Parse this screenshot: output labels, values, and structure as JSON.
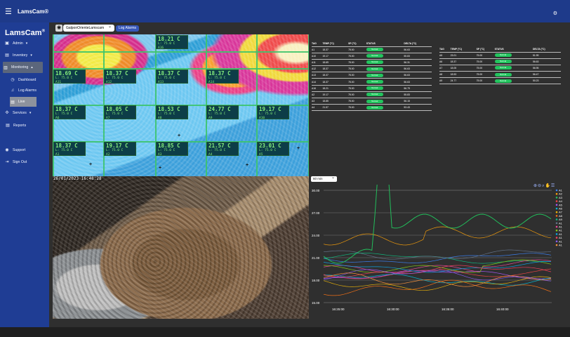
{
  "app": {
    "topbar_title": "LamsCam®",
    "brand": "LamsCam",
    "brand_mark": "®"
  },
  "sidebar": {
    "items": [
      {
        "label": "Admin",
        "icon": "admin-icon"
      },
      {
        "label": "Inventory",
        "icon": "inventory-icon"
      },
      {
        "label": "Monitoring",
        "icon": "monitoring-icon"
      },
      {
        "label": "Dashboard",
        "icon": "dashboard-icon"
      },
      {
        "label": "Log Alarms",
        "icon": "bell-icon"
      },
      {
        "label": "Live",
        "icon": "live-icon"
      },
      {
        "label": "Services",
        "icon": "services-icon"
      },
      {
        "label": "Reports",
        "icon": "reports-icon"
      },
      {
        "label": "Support",
        "icon": "support-icon"
      },
      {
        "label": "Sign Out",
        "icon": "sign-out-icon"
      }
    ],
    "admin_arrow": "▾",
    "inventory_arrow": "▾",
    "monitoring_arrow": "▴",
    "services_arrow": "▾"
  },
  "camera": {
    "selected": "GalponOrienteLamscam",
    "log_button": "Log Alarms",
    "timestamp": "26/01/2023 16:48:28",
    "readings": [
      {
        "temp": "18.21 C",
        "sp": "L: 75.0 C",
        "tag": "A16"
      },
      {
        "temp": "18.69 C",
        "sp": "L: 75.0 C",
        "tag": "A11"
      },
      {
        "temp": "18.37 C",
        "sp": "L: 75.0 C",
        "tag": "A12"
      },
      {
        "temp": "18.37 C",
        "sp": "L: 75.0 C",
        "tag": "A13"
      },
      {
        "temp": "18.37 C",
        "sp": "L: 75.0 C",
        "tag": "A14"
      },
      {
        "temp": "18.37 C",
        "sp": "L: 75.0 C",
        "tag": "A6"
      },
      {
        "temp": "18.05 C",
        "sp": "L: 75.0 C",
        "tag": "A7"
      },
      {
        "temp": "18.53 C",
        "sp": "L: 75.0 C",
        "tag": "A8"
      },
      {
        "temp": "24.77 C",
        "sp": "L: 75.0 C",
        "tag": "A9"
      },
      {
        "temp": "19.17 C",
        "sp": "L: 75.0 C",
        "tag": "A10"
      },
      {
        "temp": "18.37 C",
        "sp": "L: 75.0 C",
        "tag": "A1"
      },
      {
        "temp": "19.17 C",
        "sp": "L: 75.0 C",
        "tag": "A2"
      },
      {
        "temp": "18.85 C",
        "sp": "L: 75.0 C",
        "tag": "A3"
      },
      {
        "temp": "21.57 C",
        "sp": "L: 75.0 C",
        "tag": "A4"
      },
      {
        "temp": "23.01 C",
        "sp": "L: 75.0 C",
        "tag": "A5"
      }
    ]
  },
  "tables": {
    "headers": [
      "TAG",
      "TEMP (°C)",
      "SP (°C)",
      "STATUS",
      "DELTA (°C)"
    ],
    "left": [
      [
        "A1",
        "18.37",
        "75.00",
        "Normal",
        "56.63"
      ],
      [
        "A10",
        "19.17",
        "75.00",
        "Normal",
        "55.83"
      ],
      [
        "A11",
        "18.69",
        "75.00",
        "Normal",
        "56.31"
      ],
      [
        "A12",
        "18.37",
        "75.00",
        "Normal",
        "56.63"
      ],
      [
        "A13",
        "18.37",
        "75.00",
        "Normal",
        "56.63"
      ],
      [
        "A14",
        "18.37",
        "75.00",
        "Normal",
        "56.63"
      ],
      [
        "A16",
        "18.21",
        "75.00",
        "Normal",
        "56.79"
      ],
      [
        "A2",
        "19.17",
        "75.00",
        "Normal",
        "55.83"
      ],
      [
        "A3",
        "18.85",
        "75.00",
        "Normal",
        "56.15"
      ],
      [
        "A4",
        "21.57",
        "75.00",
        "Normal",
        "53.43"
      ]
    ],
    "right": [
      [
        "A5",
        "23.01",
        "75.00",
        "Normal",
        "51.99"
      ],
      [
        "A6",
        "18.37",
        "75.00",
        "Normal",
        "56.63"
      ],
      [
        "A7",
        "18.05",
        "75.00",
        "Normal",
        "56.95"
      ],
      [
        "A8",
        "18.53",
        "75.00",
        "Normal",
        "56.47"
      ],
      [
        "A9",
        "24.77",
        "75.00",
        "Normal",
        "50.23"
      ]
    ]
  },
  "chart": {
    "range": "60 min",
    "yticks": [
      "30.00",
      "27.00",
      "24.00",
      "21.00",
      "18.00",
      "15.00"
    ],
    "xticks": [
      "16:25:00",
      "16:30:00",
      "16:35:00",
      "16:40:00"
    ],
    "legend": [
      "A1",
      "A2",
      "A3",
      "A4",
      "A5",
      "A6",
      "A7",
      "A8",
      "A9",
      "A10",
      "A11",
      "A12",
      "A13",
      "A14",
      "A15",
      "A16"
    ],
    "colors": {
      "accent": "#1f3d94",
      "status": "#22c55e",
      "series": [
        "#3b82f6",
        "#f59e0b",
        "#22c55e",
        "#ef4444",
        "#a855f7",
        "#06b6d4",
        "#eab308",
        "#f97316",
        "#10b981",
        "#64748b",
        "#ec4899",
        "#84cc16",
        "#0ea5e9",
        "#f43f5e",
        "#8b5cf6",
        "#fb923c"
      ]
    }
  }
}
